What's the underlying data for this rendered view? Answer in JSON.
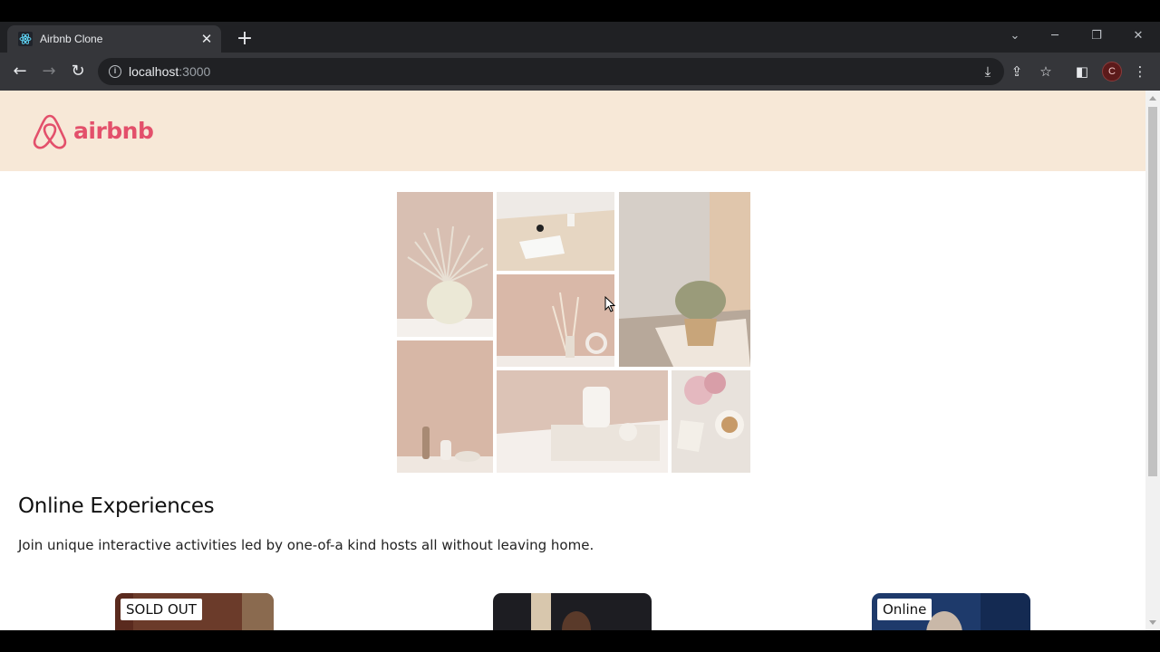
{
  "browser": {
    "tab_title": "Airbnb Clone",
    "tab_close": "✕",
    "new_tab": "+",
    "url_host": "localhost",
    "url_port": ":3000",
    "profile_initial": "C"
  },
  "navbar": {
    "logo_text": "airbnb",
    "brand_color": "#e3506b",
    "background": "#f7e8d7"
  },
  "hero": {
    "tiles": [
      {
        "name": "pampas-vase-tile",
        "color": "#d8bfb2"
      },
      {
        "name": "desk-notebook-tile",
        "color": "#e3d8cf"
      },
      {
        "name": "plant-curtain-tile",
        "color": "#cbbfb3"
      },
      {
        "name": "dried-grass-tile",
        "color": "#d9b8a8"
      },
      {
        "name": "ceramics-shelf-tile",
        "color": "#d7b7a6"
      },
      {
        "name": "mug-books-tile",
        "color": "#dcc3b6"
      },
      {
        "name": "peonies-coffee-tile",
        "color": "#e8e2dc"
      }
    ]
  },
  "section": {
    "title": "Online Experiences",
    "description": "Join unique interactive activities led by one-of-a kind hosts all without leaving home."
  },
  "cards": [
    {
      "badge": "SOLD OUT",
      "color": "#6b3b2a"
    },
    {
      "badge": "",
      "color": "#1d1d22"
    },
    {
      "badge": "Online",
      "color": "#1e3a6b"
    }
  ]
}
